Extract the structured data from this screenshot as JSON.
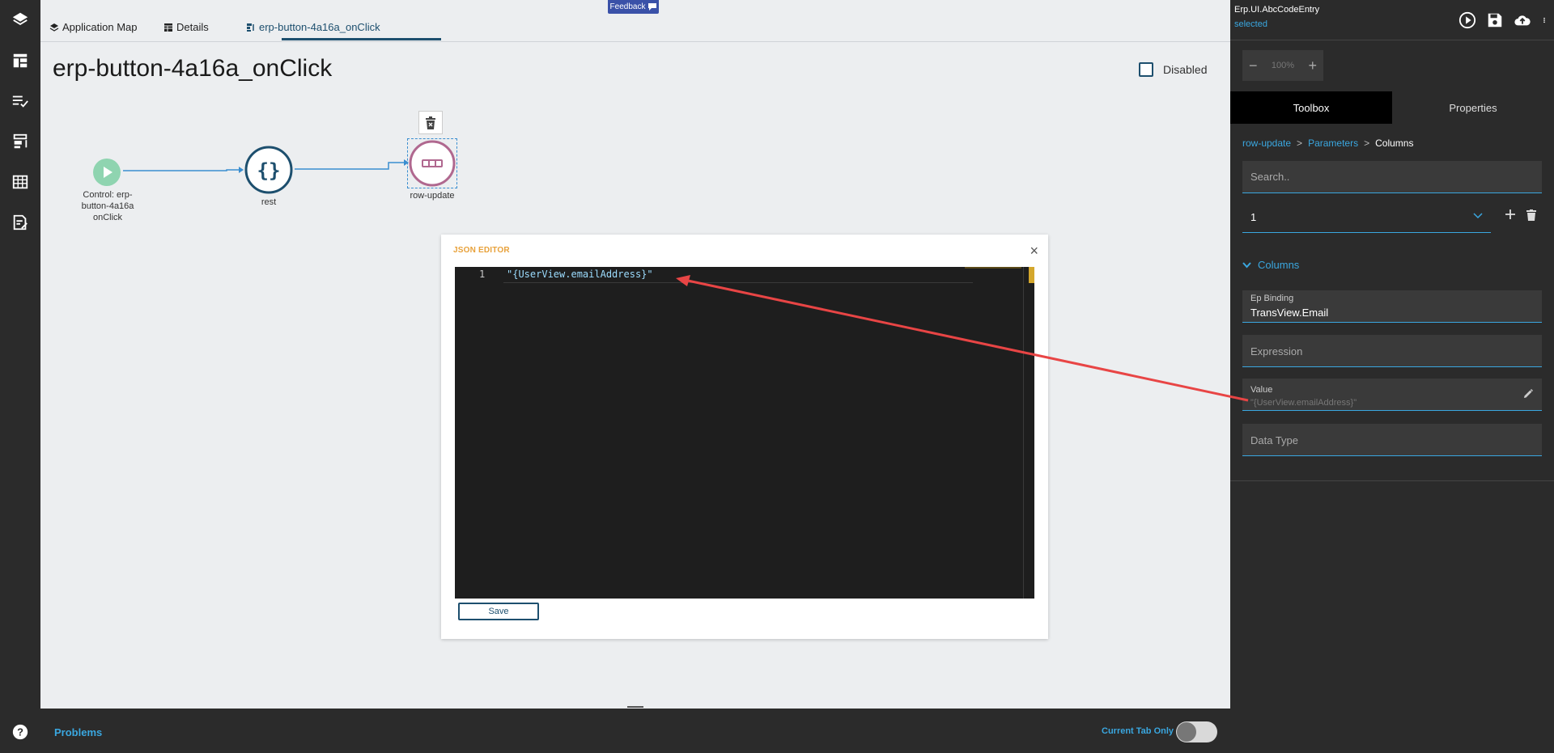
{
  "feedback": {
    "label": "Feedback"
  },
  "tabs": [
    {
      "label": "Application Map"
    },
    {
      "label": "Details"
    },
    {
      "label": "erp-button-4a16a_onClick"
    }
  ],
  "page": {
    "title": "erp-button-4a16a_onClick",
    "disabled_label": "Disabled",
    "disabled_checked": false
  },
  "flow": {
    "nodes": [
      {
        "label_lines": [
          "Control: erp-",
          "button-4a16a",
          "onClick"
        ]
      },
      {
        "label": "rest",
        "glyph": "{}"
      },
      {
        "label": "row-update"
      }
    ]
  },
  "json_editor": {
    "title": "JSON EDITOR",
    "close": "×",
    "line_number": "1",
    "code": "\"{UserView.emailAddress}\"",
    "save_label": "Save"
  },
  "bottom": {
    "problems": "Problems",
    "current_tab_only": "Current Tab Only",
    "toggle_on": false
  },
  "right_panel": {
    "title": "Erp.UI.AbcCodeEntry",
    "status": "selected",
    "zoom": {
      "value": "100%",
      "minus": "−",
      "plus": "+"
    },
    "tabs": [
      {
        "label": "Toolbox"
      },
      {
        "label": "Properties"
      }
    ],
    "breadcrumb": [
      "row-update",
      "Parameters",
      "Columns"
    ],
    "search_placeholder": "Search..",
    "select_value": "1",
    "section": "Columns",
    "fields": {
      "ep_binding": {
        "label": "Ep Binding",
        "value": "TransView.Email"
      },
      "expression": {
        "placeholder": "Expression"
      },
      "value": {
        "label": "Value",
        "value": "\"{UserView.emailAddress}\""
      },
      "data_type": {
        "placeholder": "Data Type"
      }
    }
  },
  "colors": {
    "accent": "#3aa7e0",
    "dark": "#2b2b2b",
    "brand": "#1d4f6e",
    "arrow": "#e84545"
  }
}
